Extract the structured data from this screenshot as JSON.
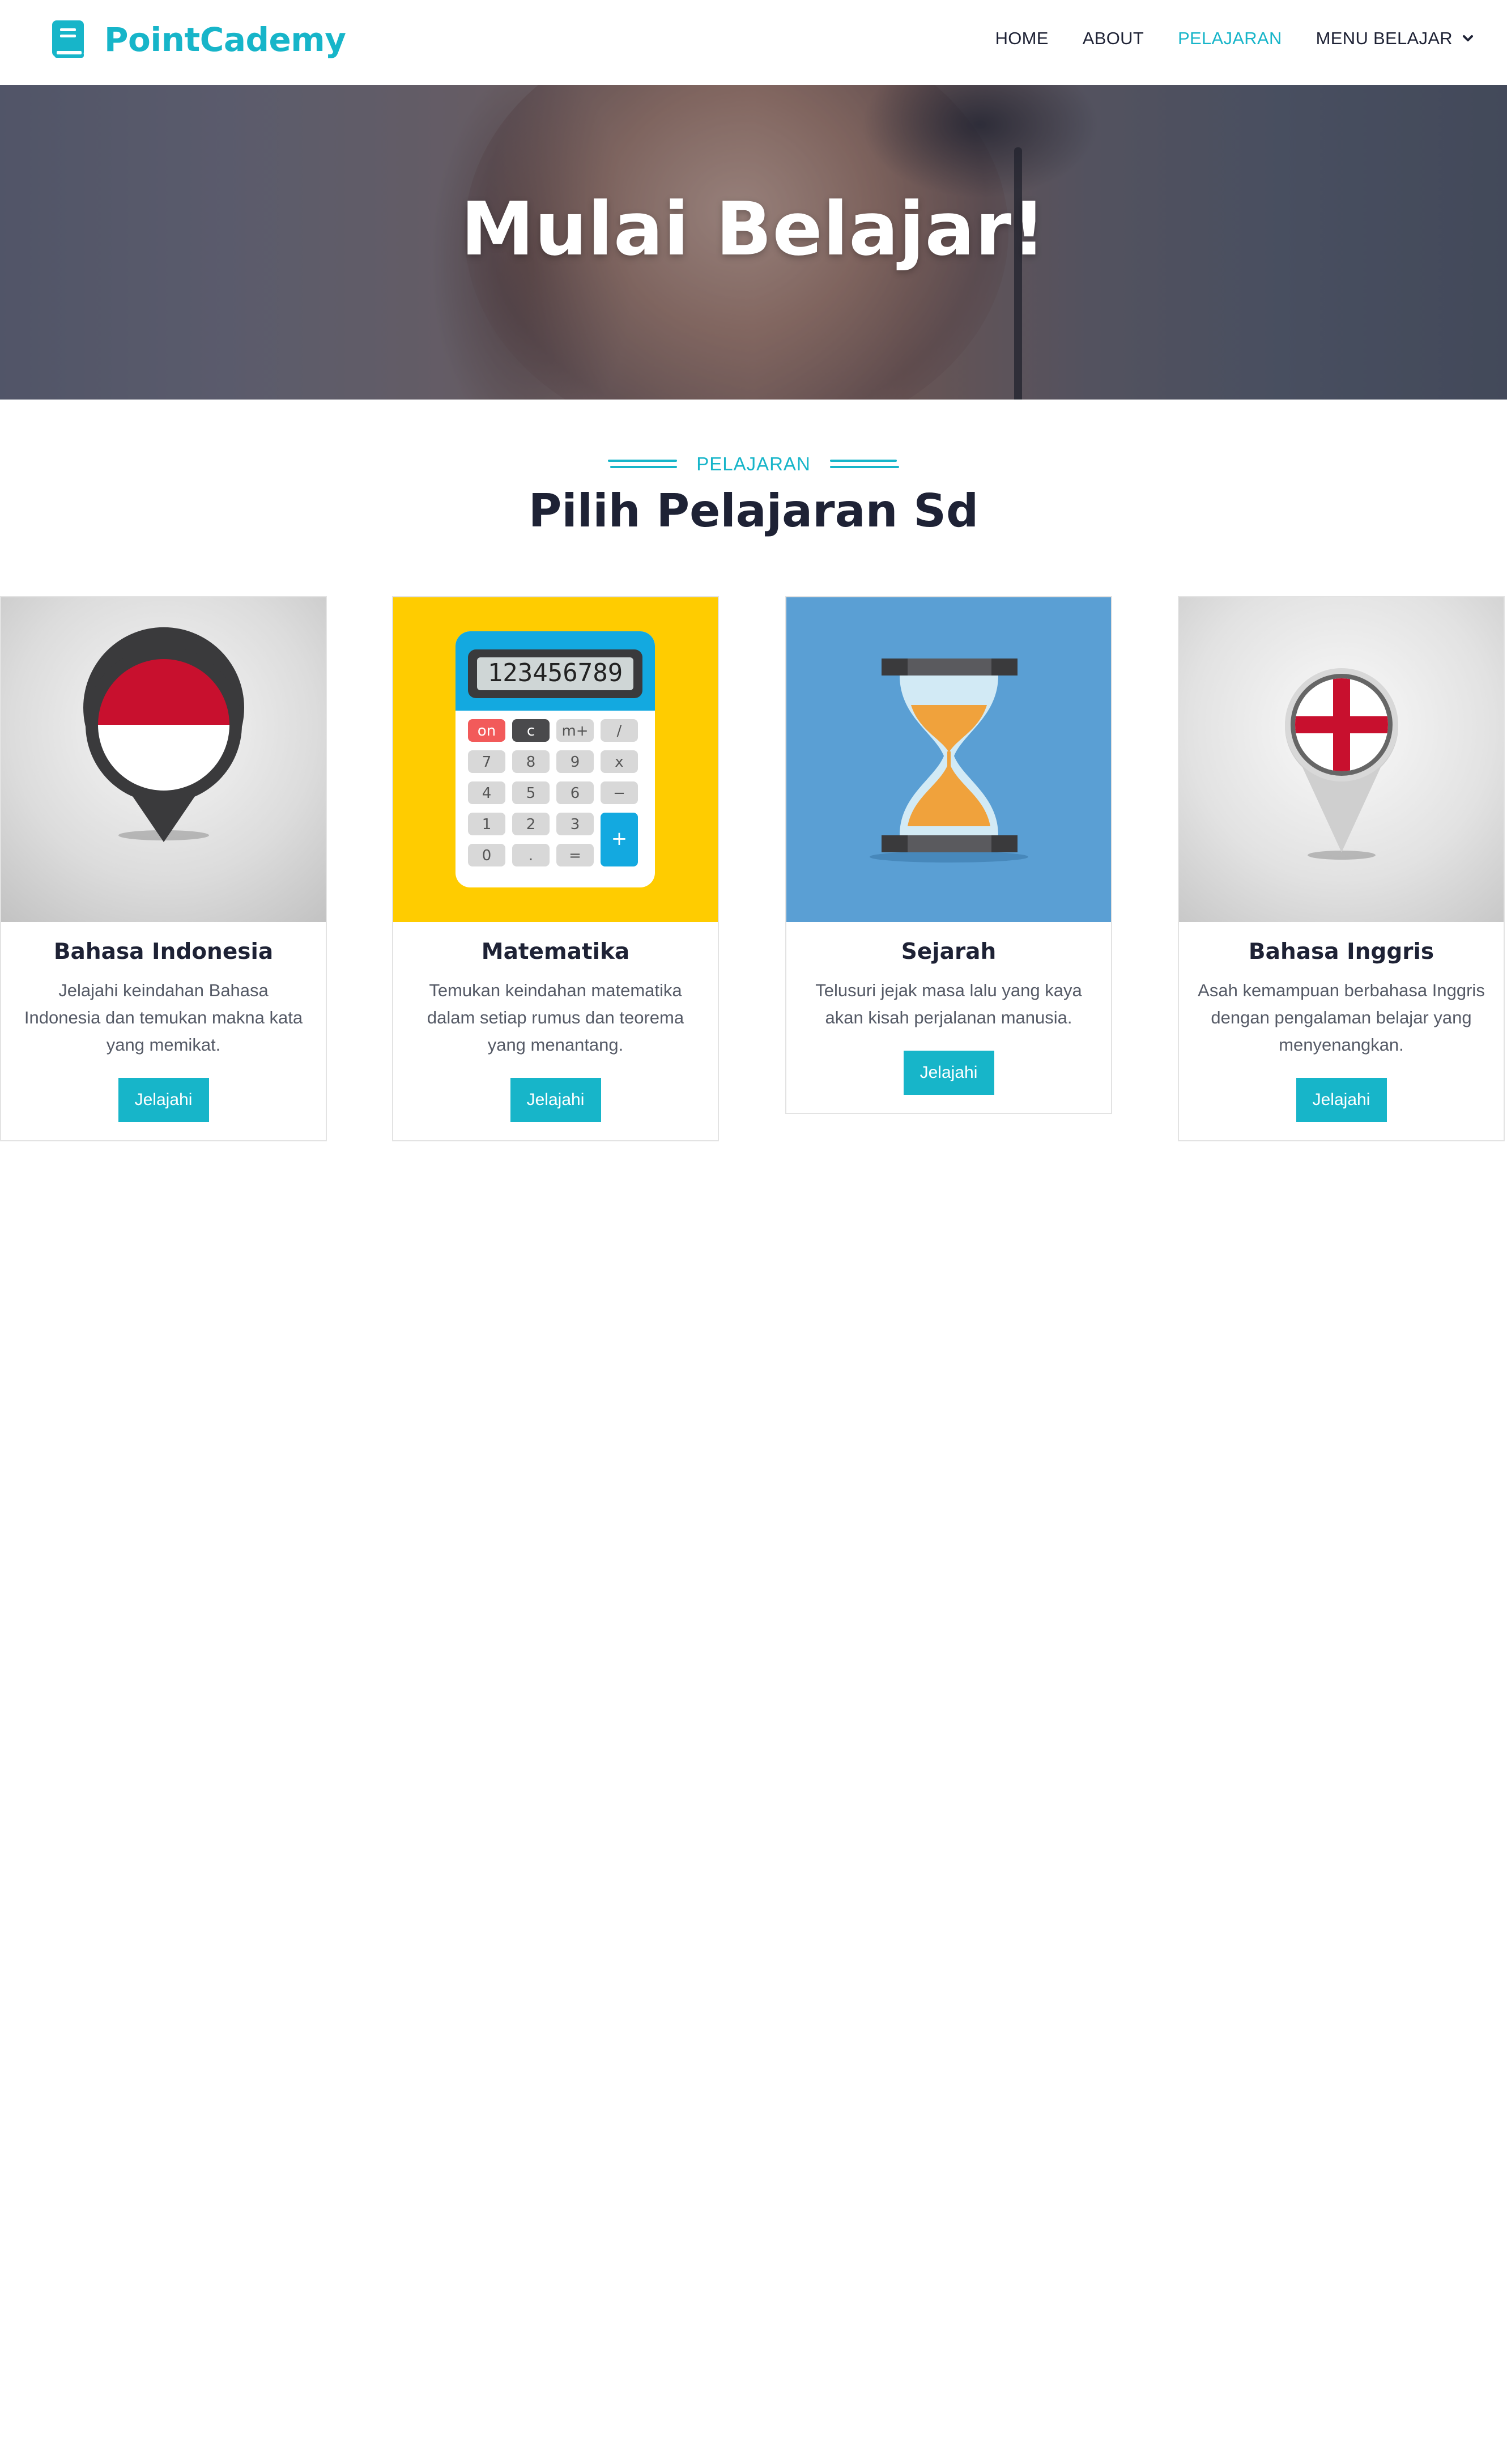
{
  "brand": {
    "name": "PointCademy",
    "icon": "book-icon",
    "accent": "#17b5c9"
  },
  "nav": {
    "items": [
      {
        "label": "HOME",
        "active": false
      },
      {
        "label": "ABOUT",
        "active": false
      },
      {
        "label": "PELAJARAN",
        "active": true
      },
      {
        "label": "MENU BELAJAR",
        "active": false,
        "dropdown": true
      }
    ]
  },
  "hero": {
    "title": "Mulai Belajar!"
  },
  "section": {
    "label": "PELAJARAN",
    "title": "Pilih Pelajaran Sd"
  },
  "cards": [
    {
      "title": "Bahasa Indonesia",
      "description": "Jelajahi keindahan Bahasa Indonesia dan temukan makna kata yang memikat.",
      "button": "Jelajahi",
      "icon": "indonesia-flag-pin-icon"
    },
    {
      "title": "Matematika",
      "description": "Temukan keindahan matematika dalam setiap rumus dan teorema yang menantang.",
      "button": "Jelajahi",
      "icon": "calculator-icon",
      "calculator": {
        "display": "123456789",
        "keys": [
          "on",
          "c",
          "m+",
          "/",
          "7",
          "8",
          "9",
          "x",
          "4",
          "5",
          "6",
          "−",
          "1",
          "2",
          "3",
          "+",
          "0",
          ".",
          "="
        ]
      }
    },
    {
      "title": "Sejarah",
      "description": "Telusuri jejak masa lalu yang kaya akan kisah perjalanan manusia.",
      "button": "Jelajahi",
      "icon": "hourglass-icon"
    },
    {
      "title": "Bahasa Inggris",
      "description": "Asah kemampuan berbahasa Inggris dengan pengalaman belajar yang menyenangkan.",
      "button": "Jelajahi",
      "icon": "england-flag-pin-icon"
    }
  ]
}
